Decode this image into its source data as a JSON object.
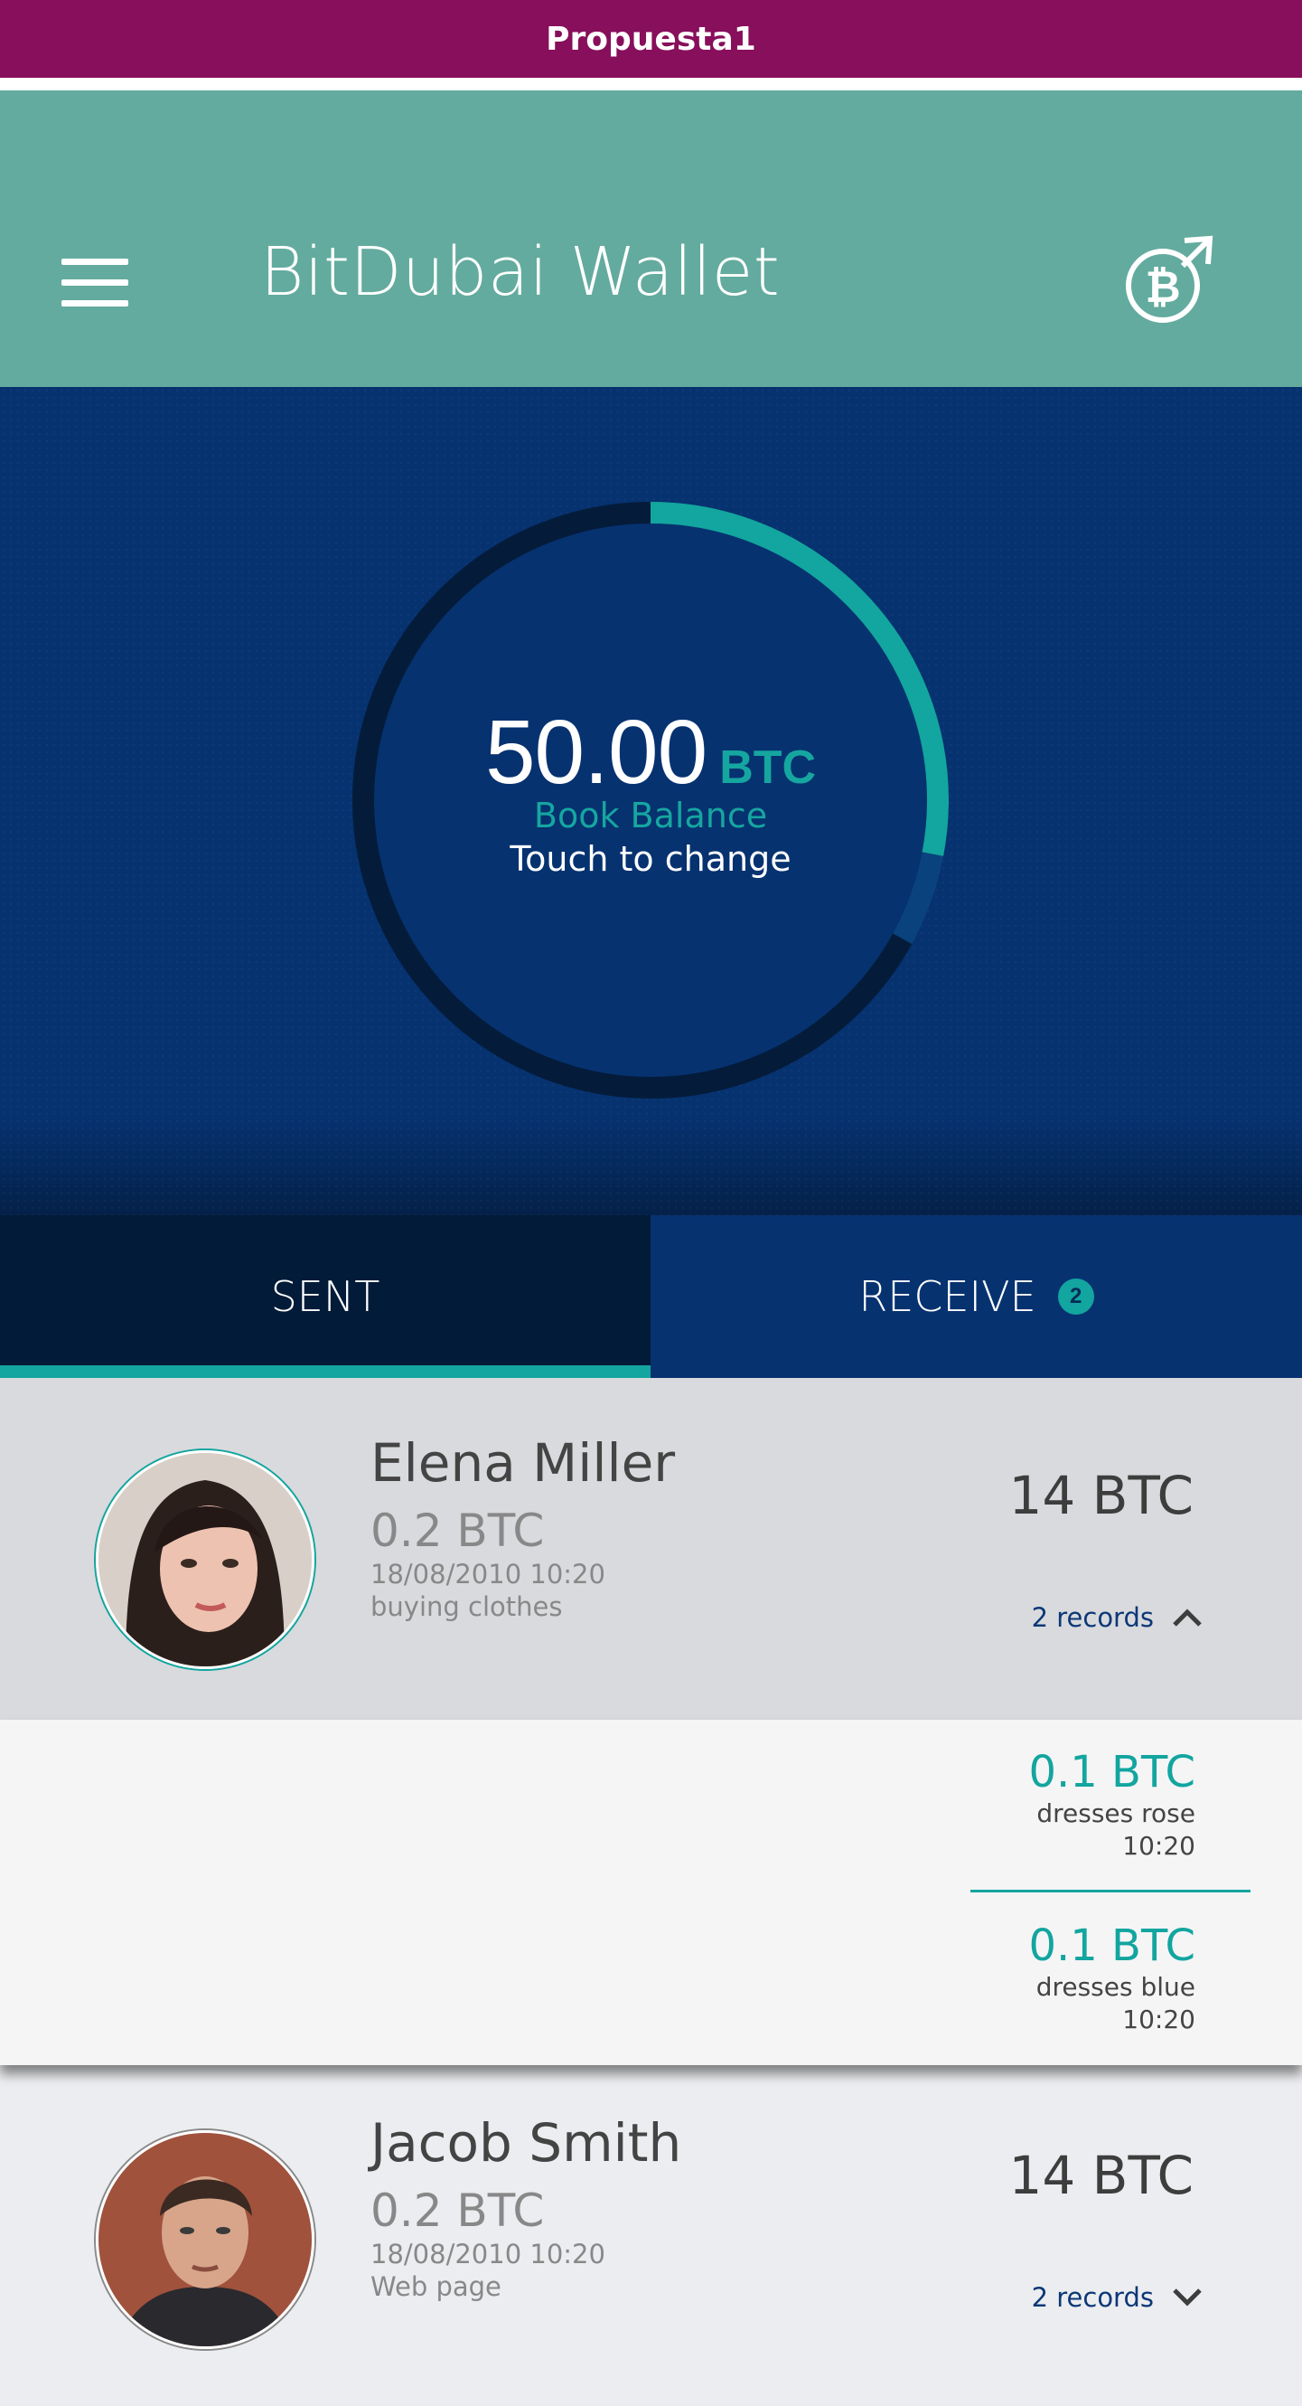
{
  "top_bar": {
    "title": "Propuesta1"
  },
  "app_bar": {
    "title": "BitDubai Wallet",
    "menu_icon": "hamburger-menu-icon",
    "action_icon": "bitcoin-send-icon"
  },
  "balance": {
    "value": "50.00",
    "unit": "BTC",
    "label": "Book Balance",
    "hint": "Touch to change",
    "ring_progress": 0.28
  },
  "tabs": {
    "sent_label": "SENT",
    "receive_label": "RECEIVE",
    "receive_badge": "2",
    "active": "sent"
  },
  "transactions": [
    {
      "name": "Elena Miller",
      "amount": "0.2 BTC",
      "date": "18/08/2010 10:20",
      "note": "buying clothes",
      "total": "14 BTC",
      "records_label": "2 records",
      "expanded": true,
      "records": [
        {
          "amount": "0.1 BTC",
          "desc": "dresses rose",
          "time": "10:20"
        },
        {
          "amount": "0.1 BTC",
          "desc": "dresses blue",
          "time": "10:20"
        }
      ]
    },
    {
      "name": "Jacob Smith",
      "amount": "0.2 BTC",
      "date": "18/08/2010 10:20",
      "note": "Web page",
      "total": "14 BTC",
      "records_label": "2 records",
      "expanded": false
    }
  ],
  "colors": {
    "top_bar": "#870f5b",
    "app_bar": "#63ab9e",
    "balance_bg": "#063270",
    "accent": "#13a59f",
    "tab_active_bg": "#021b38"
  }
}
